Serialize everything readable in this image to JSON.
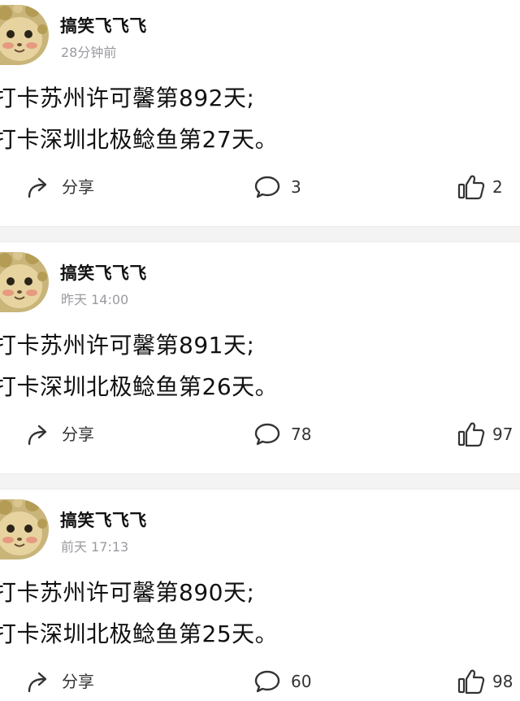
{
  "posts": [
    {
      "username": "搞笑飞飞飞",
      "timestamp": "28分钟前",
      "lines": [
        "打卡苏州许可馨第892天;",
        "打卡深圳北极鲶鱼第27天。"
      ],
      "share_label": "分享",
      "comment_count": "3",
      "like_count": "2"
    },
    {
      "username": "搞笑飞飞飞",
      "timestamp": "昨天 14:00",
      "lines": [
        "打卡苏州许可馨第891天;",
        "打卡深圳北极鲶鱼第26天。"
      ],
      "share_label": "分享",
      "comment_count": "78",
      "like_count": "97"
    },
    {
      "username": "搞笑飞飞飞",
      "timestamp": "前天 17:13",
      "lines": [
        "打卡苏州许可馨第890天;",
        "打卡深圳北极鲶鱼第25天。"
      ],
      "share_label": "分享",
      "comment_count": "60",
      "like_count": "98"
    }
  ],
  "icons": {
    "share": "share-arrow-icon",
    "comment": "comment-bubble-icon",
    "like": "thumbs-up-icon"
  },
  "colors": {
    "text": "#111111",
    "meta": "#9a9aa0",
    "action_text": "#333333",
    "separator": "#f3f3f4"
  }
}
